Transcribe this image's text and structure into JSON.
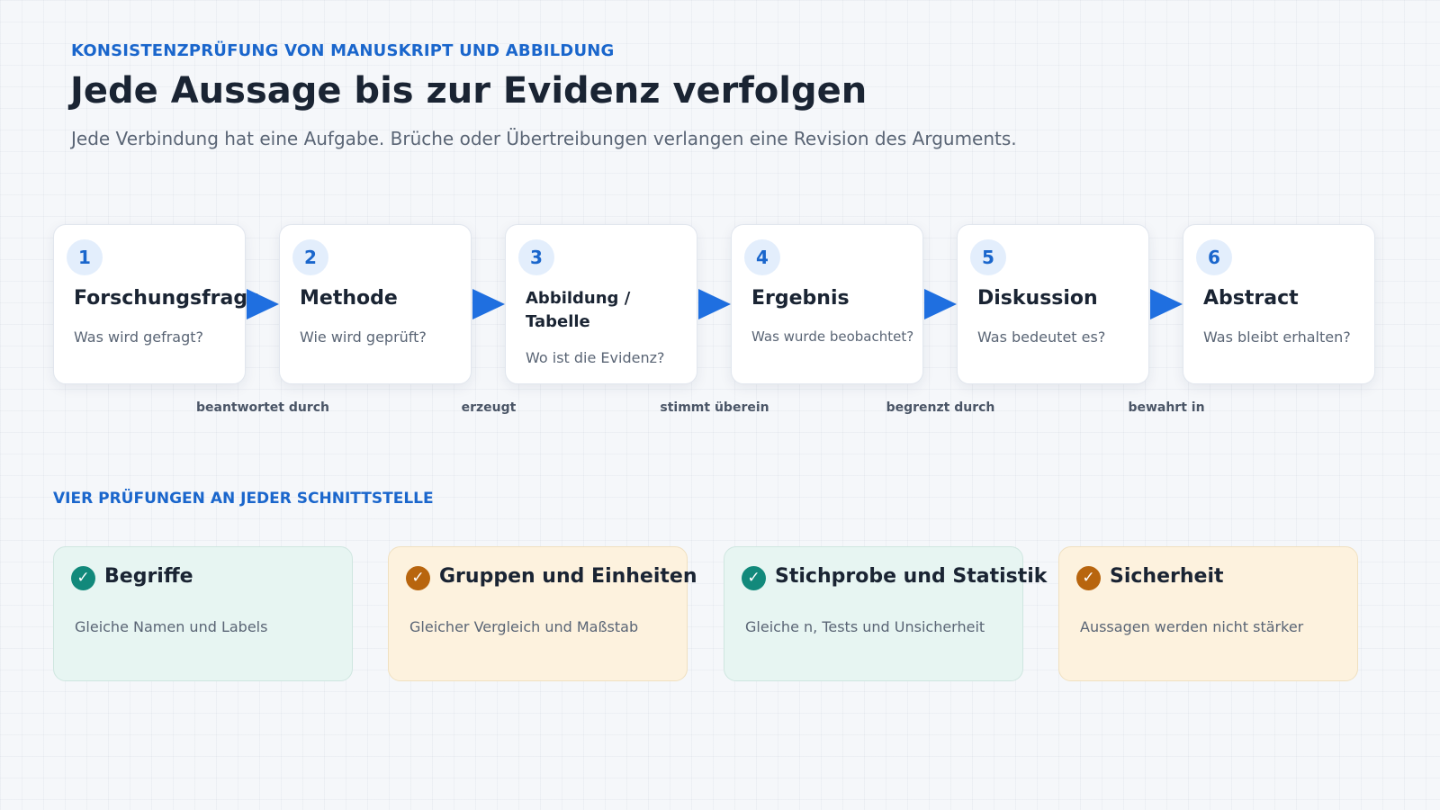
{
  "header": {
    "eyebrow": "KONSISTENZPRÜFUNG VON MANUSKRIPT UND ABBILDUNG",
    "title": "Jede Aussage bis zur Evidenz verfolgen",
    "subtitle": "Jede Verbindung hat eine Aufgabe. Brüche oder Übertreibungen verlangen eine Revision des Arguments."
  },
  "flow": {
    "steps": [
      {
        "number": "1",
        "title": "Forschungsfrage",
        "question": "Was wird gefragt?"
      },
      {
        "number": "2",
        "title": "Methode",
        "question": "Wie wird geprüft?"
      },
      {
        "number": "3",
        "title": "Abbildung / Tabelle",
        "question": "Wo ist die Evidenz?"
      },
      {
        "number": "4",
        "title": "Ergebnis",
        "question": "Was wurde beobachtet?"
      },
      {
        "number": "5",
        "title": "Diskussion",
        "question": "Was bedeutet es?"
      },
      {
        "number": "6",
        "title": "Abstract",
        "question": "Was bleibt erhalten?"
      }
    ],
    "connectors": [
      "beantwortet durch",
      "erzeugt",
      "stimmt überein",
      "begrenzt durch",
      "bewahrt in"
    ],
    "arrow_color": "#1f6fe0"
  },
  "checks": {
    "section_label": "VIER PRÜFUNGEN AN JEDER SCHNITTSTELLE",
    "items": [
      {
        "title": "Begriffe",
        "description": "Gleiche Namen und Labels",
        "icon": "check-circle-icon",
        "color": "#12897b"
      },
      {
        "title": "Gruppen und Einheiten",
        "description": "Gleicher Vergleich und Maßstab",
        "icon": "check-circle-icon",
        "color": "#b8650e"
      },
      {
        "title": "Stichprobe und Statistik",
        "description": "Gleiche n, Tests und Unsicherheit",
        "icon": "check-circle-icon",
        "color": "#12897b"
      },
      {
        "title": "Sicherheit",
        "description": "Aussagen werden nicht stärker",
        "icon": "check-circle-icon",
        "color": "#b8650e"
      }
    ]
  }
}
